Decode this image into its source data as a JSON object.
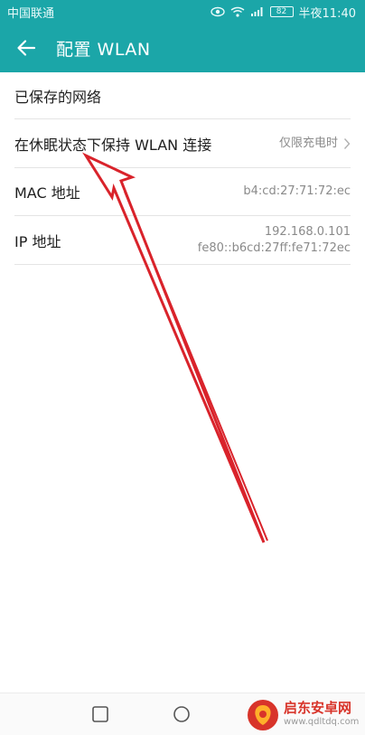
{
  "status_bar": {
    "carrier": "中国联通",
    "battery": "82",
    "time": "半夜11:40"
  },
  "app_bar": {
    "title": "配置 WLAN"
  },
  "list": {
    "saved_networks": "已保存的网络",
    "sleep_label": "在休眠状态下保持 WLAN 连接",
    "sleep_value": "仅限充电时",
    "mac_label": "MAC 地址",
    "mac_value": "b4:cd:27:71:72:ec",
    "ip_label": "IP 地址",
    "ip_value_v4": "192.168.0.101",
    "ip_value_v6": "fe80::b6cd:27ff:fe71:72ec"
  },
  "watermark": {
    "title": "启东安卓网",
    "url": "www.qdltdq.com"
  },
  "colors": {
    "app_bar": "#1ba6a8",
    "annotation_arrow": "#d9232b",
    "watermark_red": "#d8342a"
  }
}
